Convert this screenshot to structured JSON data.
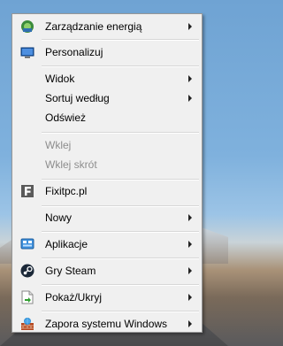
{
  "menu": {
    "items": [
      {
        "label": "Zarządzanie energią",
        "submenu": true,
        "icon": "power-management-icon"
      },
      {
        "label": "Personalizuj",
        "submenu": false,
        "icon": "personalize-monitor-icon"
      },
      {
        "label": "Widok",
        "submenu": true
      },
      {
        "label": "Sortuj według",
        "submenu": true
      },
      {
        "label": "Odśwież",
        "submenu": false
      },
      {
        "label": "Wklej",
        "submenu": false,
        "disabled": true
      },
      {
        "label": "Wklej skrót",
        "submenu": false,
        "disabled": true
      },
      {
        "label": "Fixitpc.pl",
        "submenu": false,
        "icon": "fixitpc-f-icon"
      },
      {
        "label": "Nowy",
        "submenu": true
      },
      {
        "label": "Aplikacje",
        "submenu": true,
        "icon": "applications-icon"
      },
      {
        "label": "Gry Steam",
        "submenu": true,
        "icon": "steam-icon"
      },
      {
        "label": "Pokaż/Ukryj",
        "submenu": true,
        "icon": "show-hide-icon"
      },
      {
        "label": "Zapora systemu Windows",
        "submenu": true,
        "icon": "windows-firewall-icon"
      }
    ]
  }
}
